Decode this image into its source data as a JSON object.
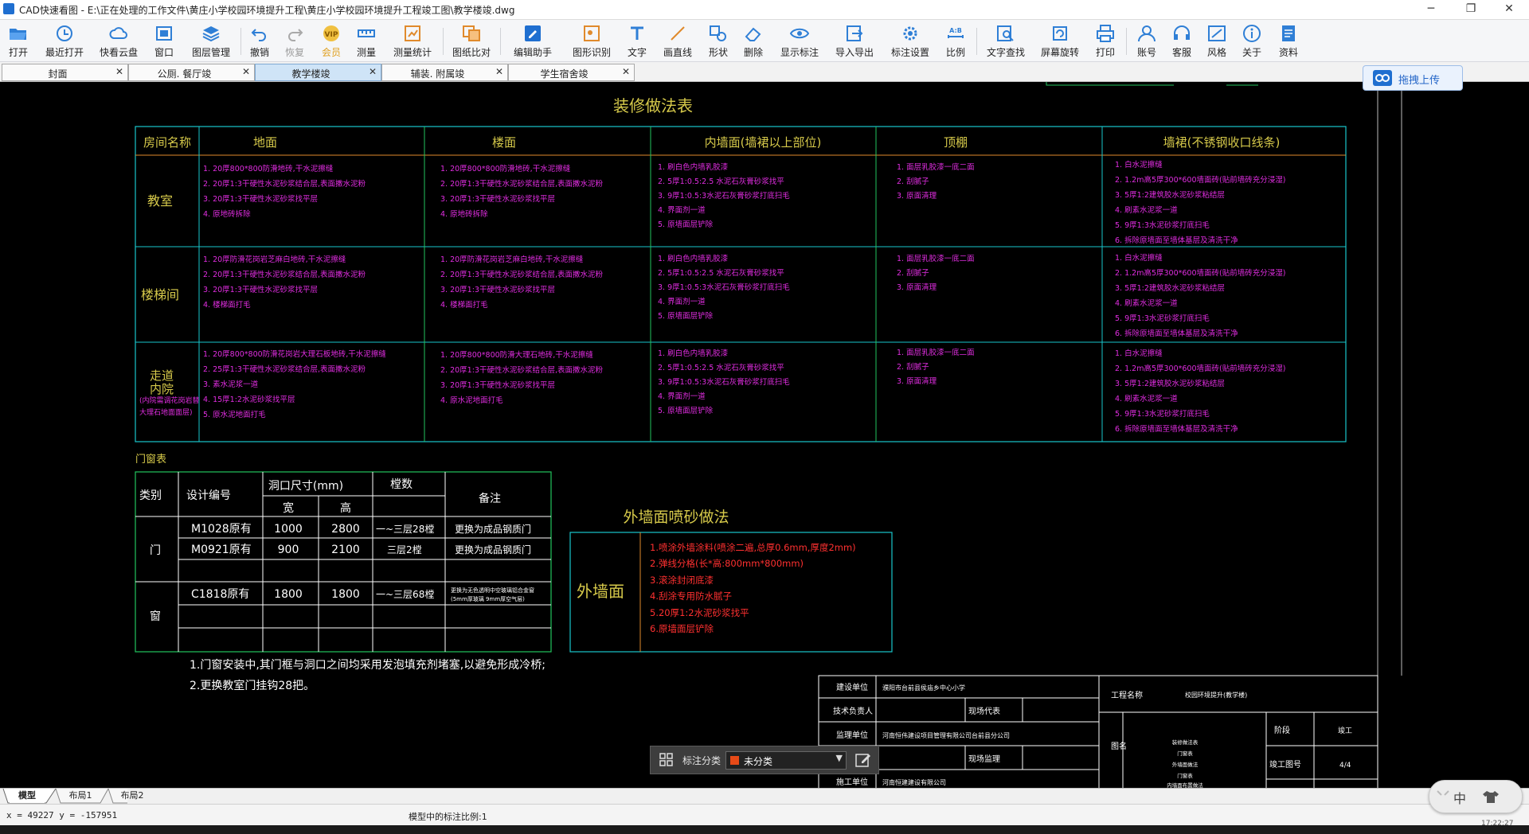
{
  "window": {
    "title": "CAD快速看图 - E:\\正在处理的工作文件\\黄庄小学校园环境提升工程\\黄庄小学校园环境提升工程竣工图\\教学楼竣.dwg",
    "minimize": "─",
    "maximize": "❐",
    "close": "✕"
  },
  "toolbar": {
    "items": [
      {
        "label": "打开",
        "icon": "folder-open-icon"
      },
      {
        "label": "最近打开",
        "icon": "recent-icon"
      },
      {
        "label": "快看云盘",
        "icon": "cloud-icon"
      },
      {
        "label": "窗口",
        "icon": "window-icon"
      },
      {
        "label": "图层管理",
        "icon": "layers-icon"
      },
      {
        "label": "撤销",
        "icon": "undo-icon"
      },
      {
        "label": "恢复",
        "icon": "redo-icon"
      },
      {
        "label": "会员",
        "icon": "vip-icon"
      },
      {
        "label": "测量",
        "icon": "measure-icon"
      },
      {
        "label": "测量统计",
        "icon": "measure-stats-icon"
      },
      {
        "label": "图纸比对",
        "icon": "compare-icon"
      },
      {
        "label": "编辑助手",
        "icon": "edit-helper-icon"
      },
      {
        "label": "图形识别",
        "icon": "recognize-icon"
      },
      {
        "label": "文字",
        "icon": "text-icon"
      },
      {
        "label": "画直线",
        "icon": "line-icon"
      },
      {
        "label": "形状",
        "icon": "shape-icon"
      },
      {
        "label": "删除",
        "icon": "eraser-icon"
      },
      {
        "label": "显示标注",
        "icon": "eye-icon"
      },
      {
        "label": "导入导出",
        "icon": "import-export-icon"
      },
      {
        "label": "标注设置",
        "icon": "annotation-settings-icon"
      },
      {
        "label": "比例",
        "icon": "scale-icon"
      },
      {
        "label": "文字查找",
        "icon": "text-search-icon"
      },
      {
        "label": "屏幕旋转",
        "icon": "rotate-screen-icon"
      },
      {
        "label": "打印",
        "icon": "printer-icon"
      },
      {
        "label": "账号",
        "icon": "account-icon"
      },
      {
        "label": "客服",
        "icon": "headset-icon"
      },
      {
        "label": "风格",
        "icon": "style-icon"
      },
      {
        "label": "关于",
        "icon": "info-icon"
      },
      {
        "label": "资料",
        "icon": "documents-icon"
      }
    ]
  },
  "tabs": [
    {
      "label": "封面",
      "close": "✕"
    },
    {
      "label": "公厕. 餐厅竣",
      "close": "✕"
    },
    {
      "label": "教学楼竣",
      "close": "✕"
    },
    {
      "label": "辅装. 附属竣",
      "close": "✕"
    },
    {
      "label": "学生宿舍竣",
      "close": "✕"
    }
  ],
  "upload_button": {
    "label": "拖拽上传"
  },
  "drawing": {
    "decoration_table": {
      "title": "装修做法表",
      "headers": [
        "房间名称",
        "地面",
        "楼面",
        "内墙面(墙裙以上部位)",
        "顶棚",
        "墙裙(不锈钢收口线条)"
      ],
      "rows": [
        {
          "room": [
            "教室"
          ],
          "floor": [
            "1. 20厚800*800防滑地砖,干水泥擦缝",
            "2. 20厚1:3干硬性水泥砂浆结合层,表面撒水泥粉",
            "3. 20厚1:3干硬性水泥砂浆找平层",
            "4. 原地砖拆除"
          ],
          "upper_floor": [
            "1. 20厚800*800防滑地砖,干水泥擦缝",
            "2. 20厚1:3干硬性水泥砂浆结合层,表面撒水泥粉",
            "3. 20厚1:3干硬性水泥砂浆找平层",
            "4. 原地砖拆除"
          ],
          "interior_wall": [
            "1. 刷白色内墙乳胶漆",
            "2. 5厚1:0.5:2.5 水泥石灰膏砂浆找平",
            "3. 9厚1:0.5:3水泥石灰膏砂浆打底扫毛",
            "4. 界面剂一道",
            "5. 原墙面层铲除"
          ],
          "ceiling": [
            "1. 面层乳胶漆一底二面",
            "2. 刮腻子",
            "3. 原面清理"
          ],
          "dado": [
            "1. 白水泥擦缝",
            "2. 1.2m高5厚300*600墙面砖(贴前墙砖充分浸湿)",
            "3. 5厚1:2建筑胶水泥砂浆粘结层",
            "4. 刷素水泥浆一道",
            "5. 9厚1:3水泥砂浆打底扫毛",
            "6. 拆除原墙面至墙体基层及清洗干净"
          ]
        },
        {
          "room": [
            "楼梯间"
          ],
          "floor": [
            "1. 20厚防滑花岗岩芝麻白地砖,干水泥擦缝",
            "2. 20厚1:3干硬性水泥砂浆结合层,表面撒水泥粉",
            "3. 20厚1:3干硬性水泥砂浆找平层",
            "4. 楼梯面打毛"
          ],
          "upper_floor": [
            "1. 20厚防滑花岗岩芝麻白地砖,干水泥擦缝",
            "2. 20厚1:3干硬性水泥砂浆结合层,表面撒水泥粉",
            "3. 20厚1:3干硬性水泥砂浆找平层",
            "4. 楼梯面打毛"
          ],
          "interior_wall": [
            "1. 刷白色内墙乳胶漆",
            "2. 5厚1:0.5:2.5 水泥石灰膏砂浆找平",
            "3. 9厚1:0.5:3水泥石灰膏砂浆打底扫毛",
            "4. 界面剂一道",
            "5. 原墙面层铲除"
          ],
          "ceiling": [
            "1. 面层乳胶漆一底二面",
            "2. 刮腻子",
            "3. 原面清理"
          ],
          "dado": [
            "1. 白水泥擦缝",
            "2. 1.2m高5厚300*600墙面砖(贴前墙砖充分浸湿)",
            "3. 5厚1:2建筑胶水泥砂浆粘结层",
            "4. 刷素水泥浆一道",
            "5. 9厚1:3水泥砂浆打底扫毛",
            "6. 拆除原墙面至墙体基层及清洗干净"
          ]
        },
        {
          "room": [
            "走道",
            "内院"
          ],
          "room_note": [
            "(内院需调花岗岩替",
            "大理石地面面层)"
          ],
          "floor": [
            "1. 20厚800*800防滑花岗岩大理石板地砖,干水泥擦缝",
            "2. 25厚1:3干硬性水泥砂浆结合层,表面撒水泥粉",
            "3. 素水泥浆一道",
            "4. 15厚1:2水泥砂浆找平层",
            "5. 原水泥地面打毛"
          ],
          "upper_floor": [
            "1. 20厚800*800防滑大理石地砖,干水泥擦缝",
            "2. 20厚1:3干硬性水泥砂浆结合层,表面撒水泥粉",
            "3. 20厚1:3干硬性水泥砂浆找平层",
            "4. 原水泥地面打毛"
          ],
          "interior_wall": [
            "1. 刷白色内墙乳胶漆",
            "2. 5厚1:0.5:2.5 水泥石灰膏砂浆找平",
            "3. 9厚1:0.5:3水泥石灰膏砂浆打底扫毛",
            "4. 界面剂一道",
            "5. 原墙面层铲除"
          ],
          "ceiling": [
            "1. 面层乳胶漆一底二面",
            "2. 刮腻子",
            "3. 原面清理"
          ],
          "dado": [
            "1. 白水泥擦缝",
            "2. 1.2m高5厚300*600墙面砖(贴前墙砖充分浸湿)",
            "3. 5厚1:2建筑胶水泥砂浆粘结层",
            "4. 刷素水泥浆一道",
            "5. 9厚1:3水泥砂浆打底扫毛",
            "6. 拆除原墙面至墙体基层及清洗干净"
          ]
        }
      ]
    },
    "window_table": {
      "title": "门窗表",
      "headers": {
        "category": "类别",
        "code": "设计编号",
        "size": "洞口尺寸(mm)",
        "width": "宽",
        "height": "高",
        "count": "樘数",
        "note": "备注"
      },
      "door_label": "门",
      "window_label": "窗",
      "rows": [
        {
          "code": "M1028原有",
          "w": "1000",
          "h": "2800",
          "count": "一~三层28樘",
          "note": "更换为成品钢质门"
        },
        {
          "code": "M0921原有",
          "w": "900",
          "h": "2100",
          "count": "三层2樘",
          "note": "更换为成品钢质门"
        },
        {
          "code": "C1818原有",
          "w": "1800",
          "h": "1800",
          "count": "一~三层68樘",
          "note1": "更换为无色透明中空玻璃铝合金窗",
          "note2": "(5mm厚玻璃 9mm厚空气层)"
        }
      ],
      "notes": [
        "1.门窗安装中,其门框与洞口之间均采用发泡填充剂堵塞,以避免形成冷桥;",
        "2.更换教室门挂钩28把。"
      ]
    },
    "exterior": {
      "title": "外墙面喷砂做法",
      "label": "外墙面",
      "items": [
        "1.喷涂外墙涂料(喷涂二遍,总厚0.6mm,厚度2mm)",
        "2.弹线分格(长*高:800mm*800mm)",
        "3.滚涂封闭底漆",
        "4.刮涂专用防水腻子",
        "5.20厚1:2水泥砂浆找平",
        "6.原墙面层铲除"
      ]
    },
    "title_block": {
      "left_labels": [
        "建设单位",
        "技术负责人",
        "监理单位",
        "",
        "施工单位"
      ],
      "left_values": [
        "濮阳市台前县侯庙乡中心小学",
        "",
        "河南恒伟建设项目管理有限公司台前县分公司",
        "",
        "河南恒建建设有限公司"
      ],
      "mid_labels": [
        "",
        "现场代表",
        "",
        "现场监理",
        ""
      ],
      "project_label": "工程名称",
      "project_value": "校园环境提升(教学楼)",
      "drawing_label": "图名",
      "drawing_names": [
        "装修做法表",
        "门窗表",
        "外墙面做法",
        "门窗表",
        "内墙面布置做法"
      ],
      "stage_label": "阶段",
      "stage_value": "竣工",
      "number_label": "竣工图号",
      "number_value": "4/4"
    }
  },
  "annotation_bar": {
    "label": "标注分类",
    "value": "未分类",
    "swatch_color": "#e74a17"
  },
  "layout_tabs": [
    "模型",
    "布局1",
    "布局2"
  ],
  "status": {
    "coords": "x = 49227 y = -157951",
    "scale": "模型中的标注比例:1",
    "clock": "17:22:27"
  },
  "float_widget": {
    "text": "中"
  },
  "colors": {
    "green": "#22c55e",
    "cyan": "#19c6cc",
    "orange": "#e08a2c",
    "yellow": "#d6c94a",
    "magenta": "#e02de0",
    "red": "#ff3030",
    "white": "#ffffff",
    "accent": "#2466c8"
  }
}
